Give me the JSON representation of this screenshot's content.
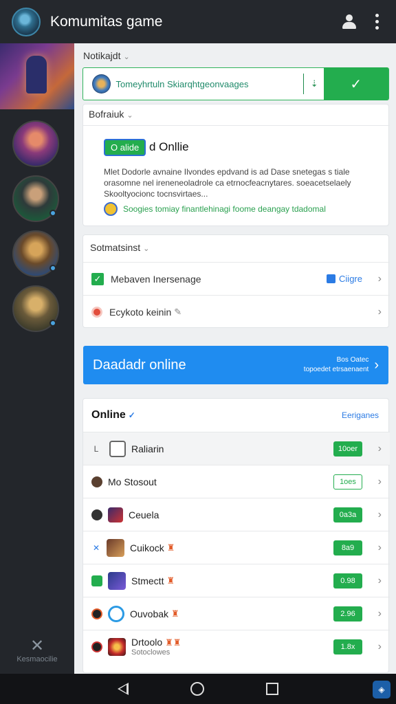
{
  "app": {
    "title": "Komumitas game"
  },
  "notify_section": {
    "label": "Notikajdt",
    "message": "Tomeyhrtuln Skiarqhtgeonvaages",
    "arrow": "⇣"
  },
  "status_section": {
    "label": "Bofraiuk",
    "pill": "O alide",
    "main_text": "d Onllie",
    "description": "Mlet Dodorle avnaine Ilvondes epdvand is ad Dase snetegas s tiale orasomne nel ireneneoladrole ca etrnocfeacnytares. soeacetselaely Skooltyocionc tocnsvirtaes...",
    "link_text": "Soogies tomiay finantlehinagi foome deangay tdadomal"
  },
  "settings_section": {
    "label": "Sotmatsinst",
    "row1_label": "Mebaven Inersenage",
    "row1_value": "Ciigre",
    "row2_label": "Ecykoto keinin"
  },
  "cta": {
    "title": "Daadadr online",
    "sub_line1": "Bos Oatec",
    "sub_line2": "topoedet etrsaenaent"
  },
  "online": {
    "title": "Online",
    "categories_label": "Eeriganes",
    "players": [
      {
        "lead": "L",
        "name": "Raliarin",
        "sub": "",
        "badge": "10oer"
      },
      {
        "lead": "",
        "name": "Mo Stosout",
        "sub": "",
        "badge": "1oes"
      },
      {
        "lead": "",
        "name": "Ceuela",
        "sub": "",
        "badge": "0a3a"
      },
      {
        "lead": "✕",
        "name": "Cuikock",
        "sub": "",
        "badge": "8a9"
      },
      {
        "lead": "",
        "name": "Stmectt",
        "sub": "",
        "badge": "0.98"
      },
      {
        "lead": "",
        "name": "Ouvobak",
        "sub": "",
        "badge": "2.96"
      },
      {
        "lead": "",
        "name": "Drtoolo",
        "sub": "Sotoclowes",
        "badge": "1.8x"
      }
    ]
  },
  "sidebar": {
    "footer_label": "Kesmaocilie"
  },
  "colors": {
    "accent_green": "#23ad4e",
    "accent_blue": "#1f8cf0",
    "topbar": "#25282d"
  },
  "icons": {
    "profile": "profile-icon",
    "menu": "kebab-menu-icon",
    "check": "check-icon",
    "chevron": "chevron-right-icon"
  }
}
